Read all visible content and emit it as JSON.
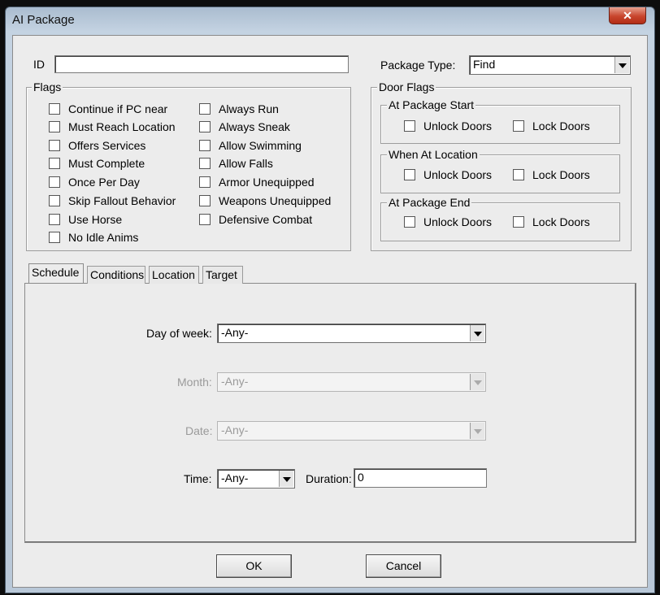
{
  "window": {
    "title": "AI Package",
    "close_icon": "✕"
  },
  "id_field": {
    "label": "ID",
    "value": ""
  },
  "package_type": {
    "label": "Package Type:",
    "value": "Find"
  },
  "flags": {
    "label": "Flags",
    "left": [
      "Continue if PC near",
      "Must Reach Location",
      "Offers Services",
      "Must Complete",
      "Once Per Day",
      "Skip Fallout Behavior",
      "Use Horse",
      "No Idle Anims"
    ],
    "right": [
      "Always Run",
      "Always Sneak",
      "Allow Swimming",
      "Allow Falls",
      "Armor Unequipped",
      "Weapons Unequipped",
      "Defensive Combat"
    ]
  },
  "door_flags": {
    "label": "Door Flags",
    "groups": [
      {
        "label": "At Package Start",
        "unlock": "Unlock Doors",
        "lock": "Lock Doors"
      },
      {
        "label": "When At Location",
        "unlock": "Unlock Doors",
        "lock": "Lock Doors"
      },
      {
        "label": "At Package End",
        "unlock": "Unlock Doors",
        "lock": "Lock Doors"
      }
    ]
  },
  "tabs": [
    "Schedule",
    "Conditions",
    "Location",
    "Target"
  ],
  "schedule": {
    "day_of_week": {
      "label": "Day of week:",
      "value": "-Any-"
    },
    "month": {
      "label": "Month:",
      "value": "-Any-"
    },
    "date": {
      "label": "Date:",
      "value": "-Any-"
    },
    "time": {
      "label": "Time:",
      "value": "-Any-"
    },
    "duration": {
      "label": "Duration:",
      "value": "0"
    }
  },
  "buttons": {
    "ok": "OK",
    "cancel": "Cancel"
  }
}
